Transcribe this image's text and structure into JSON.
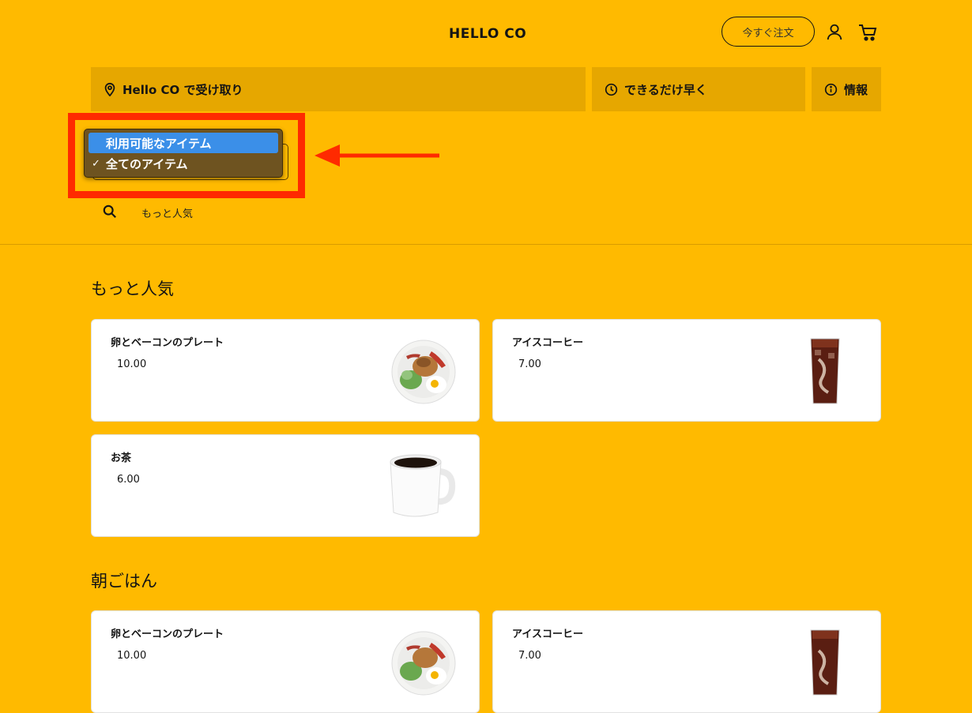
{
  "header": {
    "logo": "HELLO CO",
    "order_now": "今すぐ注文",
    "account_icon": "user-icon",
    "cart_icon": "cart-icon"
  },
  "options_bar": {
    "pickup": "Hello CO で受け取り",
    "time": "できるだけ早く",
    "info": "情報"
  },
  "filter_dropdown": {
    "options": [
      {
        "label": "利用可能なアイテム",
        "highlighted": true,
        "checked": false
      },
      {
        "label": "全てのアイテム",
        "highlighted": false,
        "checked": true
      }
    ],
    "check_mark": "✓"
  },
  "search": {
    "label": "もっと人気"
  },
  "sections": [
    {
      "title": "もっと人気",
      "items": [
        {
          "name": "卵とベーコンのプレート",
          "price": "10.00",
          "image": "egg-bacon-plate"
        },
        {
          "name": "アイスコーヒー",
          "price": "7.00",
          "image": "iced-coffee"
        },
        {
          "name": "お茶",
          "price": "6.00",
          "image": "hot-drink-mug"
        }
      ]
    },
    {
      "title": "朝ごはん",
      "items": [
        {
          "name": "卵とベーコンのプレート",
          "price": "10.00",
          "image": "egg-bacon-plate"
        },
        {
          "name": "アイスコーヒー",
          "price": "7.00",
          "image": "iced-coffee"
        }
      ]
    }
  ],
  "colors": {
    "background": "#FFBA00",
    "bar": "#E6A700",
    "annotation": "#FF2A00",
    "dropdown_highlight": "#3B8FE8"
  }
}
